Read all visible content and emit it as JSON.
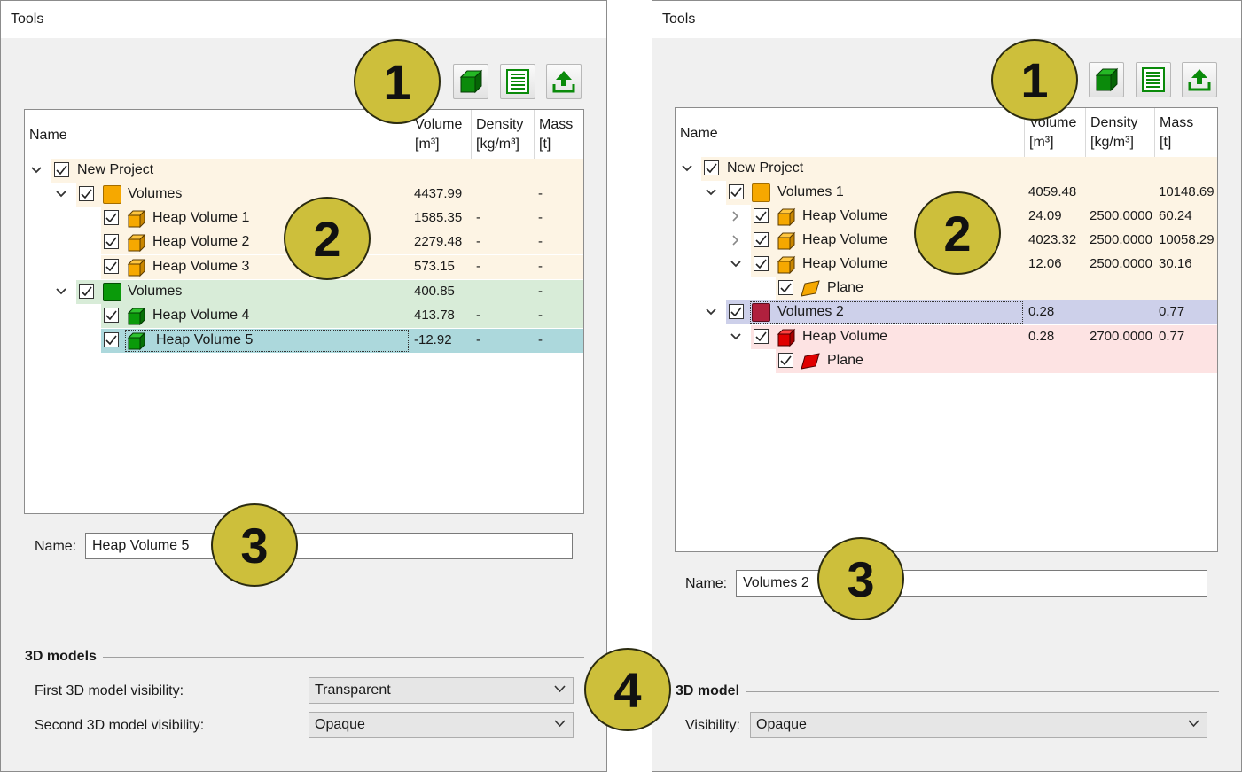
{
  "left": {
    "title": "Tools",
    "badges": [
      "1",
      "2",
      "3",
      "4"
    ],
    "columns": {
      "name": "Name",
      "volume": "Volume",
      "volume_unit": "[m³]",
      "density": "Density",
      "density_unit": "[kg/m³]",
      "mass": "Mass",
      "mass_unit": "[t]"
    },
    "rows": [
      {
        "label": "New Project",
        "volume": "",
        "density": "",
        "mass": ""
      },
      {
        "label": "Volumes",
        "volume": "4437.99",
        "density": "",
        "mass": "-"
      },
      {
        "label": "Heap Volume 1",
        "volume": "1585.35",
        "density": "-",
        "mass": "-"
      },
      {
        "label": "Heap Volume 2",
        "volume": "2279.48",
        "density": "-",
        "mass": "-"
      },
      {
        "label": "Heap Volume 3",
        "volume": "573.15",
        "density": "-",
        "mass": "-"
      },
      {
        "label": "Volumes",
        "volume": "400.85",
        "density": "",
        "mass": "-"
      },
      {
        "label": "Heap Volume 4",
        "volume": "413.78",
        "density": "-",
        "mass": "-"
      },
      {
        "label": "Heap Volume 5",
        "volume": "-12.92",
        "density": "-",
        "mass": "-"
      }
    ],
    "name_label": "Name:",
    "name_value": "Heap Volume 5",
    "section_title": "3D models",
    "first_label": "First 3D model visibility:",
    "first_value": "Transparent",
    "second_label": "Second 3D model visibility:",
    "second_value": "Opaque"
  },
  "right": {
    "title": "Tools",
    "badges": [
      "1",
      "2",
      "3"
    ],
    "columns": {
      "name": "Name",
      "volume": "Volume",
      "volume_unit": "[m³]",
      "density": "Density",
      "density_unit": "[kg/m³]",
      "mass": "Mass",
      "mass_unit": "[t]"
    },
    "rows": [
      {
        "label": "New Project",
        "volume": "",
        "density": "",
        "mass": ""
      },
      {
        "label": "Volumes 1",
        "volume": "4059.48",
        "density": "",
        "mass": "10148.69"
      },
      {
        "label": "Heap Volume",
        "volume": "24.09",
        "density": "2500.0000",
        "mass": "60.24"
      },
      {
        "label": "Heap Volume",
        "volume": "4023.32",
        "density": "2500.0000",
        "mass": "10058.29"
      },
      {
        "label": "Heap Volume",
        "volume": "12.06",
        "density": "2500.0000",
        "mass": "30.16"
      },
      {
        "label": "Plane",
        "volume": "",
        "density": "",
        "mass": ""
      },
      {
        "label": "Volumes 2",
        "volume": "0.28",
        "density": "",
        "mass": "0.77"
      },
      {
        "label": "Heap Volume",
        "volume": "0.28",
        "density": "2700.0000",
        "mass": "0.77"
      },
      {
        "label": "Plane",
        "volume": "",
        "density": "",
        "mass": ""
      }
    ],
    "name_label": "Name:",
    "name_value": "Volumes 2",
    "section_title": "3D model",
    "visibility_label": "Visibility:",
    "visibility_value": "Opaque"
  },
  "colors": {
    "group_orange_bg": "#fdf4e4",
    "group_green_bg": "#d8ecd8",
    "selected_teal_bg": "#acd8dc",
    "selected_blue_bg": "#cdd0ea",
    "group_red_bg": "#fde3e3",
    "orange_icon": "#f6a800",
    "green_icon": "#0a9a0a",
    "crimson_icon": "#b0203e",
    "red_icon": "#e00000",
    "badge": "#cdbf3b"
  },
  "icons": [
    "cube-icon",
    "report-icon",
    "export-icon",
    "chevron-down-icon",
    "chevron-right-icon",
    "checkbox-checked-icon",
    "folder-icon",
    "heap-cube-icon",
    "plane-icon"
  ]
}
